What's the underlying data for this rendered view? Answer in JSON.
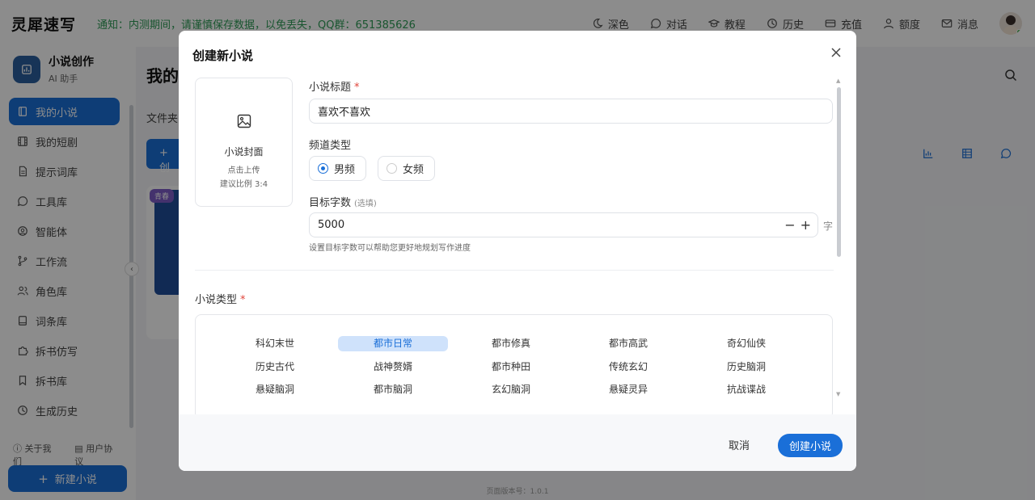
{
  "topbar": {
    "brand": "灵犀速写",
    "notice": "通知：内测期间，请谨慎保存数据，以免丢失，QQ群：651385626",
    "nav": [
      {
        "label": "深色",
        "icon": "moon-icon"
      },
      {
        "label": "对话",
        "icon": "chat-icon"
      },
      {
        "label": "教程",
        "icon": "graduation-cap-icon"
      },
      {
        "label": "历史",
        "icon": "clock-icon"
      },
      {
        "label": "充值",
        "icon": "card-icon"
      },
      {
        "label": "额度",
        "icon": "user-icon"
      },
      {
        "label": "消息",
        "icon": "mail-icon"
      }
    ]
  },
  "sidebar": {
    "title": "小说创作",
    "subtitle": "AI 助手",
    "items": [
      {
        "label": "我的小说",
        "icon": "book-icon",
        "active": true
      },
      {
        "label": "我的短剧",
        "icon": "film-icon"
      },
      {
        "label": "提示词库",
        "icon": "document-icon"
      },
      {
        "label": "工具库",
        "icon": "chat-bubble-icon"
      },
      {
        "label": "智能体",
        "icon": "bot-icon"
      },
      {
        "label": "工作流",
        "icon": "branch-icon"
      },
      {
        "label": "角色库",
        "icon": "users-icon"
      },
      {
        "label": "词条库",
        "icon": "book-icon"
      },
      {
        "label": "拆书仿写",
        "icon": "puzzle-icon"
      },
      {
        "label": "拆书库",
        "icon": "bookmark-icon"
      },
      {
        "label": "生成历史",
        "icon": "clock-icon"
      }
    ],
    "footer_links": [
      "关于我们",
      "用户协议"
    ],
    "new_button": "新建小说"
  },
  "main": {
    "title": "我的",
    "folder_label": "文件夹:",
    "create_button": "+ 创",
    "card_tag": "青春",
    "version": "页面版本号：1.0.1"
  },
  "modal": {
    "title": "创建新小说",
    "cover": {
      "label": "小说封面",
      "hint1": "点击上传",
      "hint2": "建议比例 3:4"
    },
    "title_label": "小说标题",
    "title_value": "喜欢不喜欢",
    "channel_label": "频道类型",
    "channels": [
      {
        "label": "男频",
        "selected": true
      },
      {
        "label": "女频",
        "selected": false
      }
    ],
    "target_label": "目标字数",
    "target_optional": "(选填)",
    "target_value": "5000",
    "target_unit": "字",
    "target_hint": "设置目标字数可以帮助您更好地规划写作进度",
    "stepper_minus": "−",
    "stepper_plus": "+",
    "type_label": "小说类型",
    "types": [
      [
        "科幻末世",
        "都市日常",
        "都市修真",
        "都市高武",
        "奇幻仙侠"
      ],
      [
        "历史古代",
        "战神赘婿",
        "都市种田",
        "传统玄幻",
        "历史脑洞"
      ],
      [
        "悬疑脑洞",
        "都市脑洞",
        "玄幻脑洞",
        "悬疑灵异",
        "抗战谍战"
      ]
    ],
    "selected_type": "都市日常",
    "cancel": "取消",
    "create": "创建小说",
    "required_mark": "*"
  }
}
